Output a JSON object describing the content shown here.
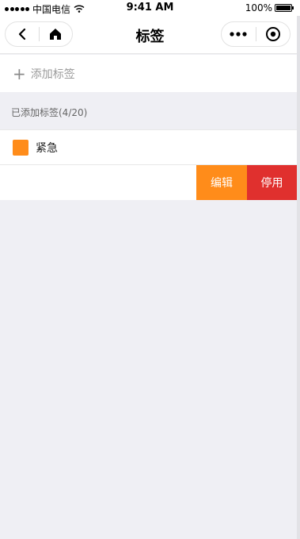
{
  "status_bar": {
    "carrier": "中国电信",
    "time": "9:41 AM",
    "battery": "100%"
  },
  "navbar": {
    "title": "标签",
    "icons": [
      "back-icon",
      "home-icon",
      "more-icon",
      "target-icon"
    ]
  },
  "add_tag": {
    "label": "添加标签"
  },
  "section": {
    "label": "已添加标签(4/20)"
  },
  "tags": [
    {
      "name": "紧急",
      "color": "#ff8c1a"
    }
  ],
  "actions": {
    "edit_label": "编辑",
    "disable_label": "停用",
    "edit_color": "#ff8c1a",
    "disable_color": "#e0302e"
  }
}
